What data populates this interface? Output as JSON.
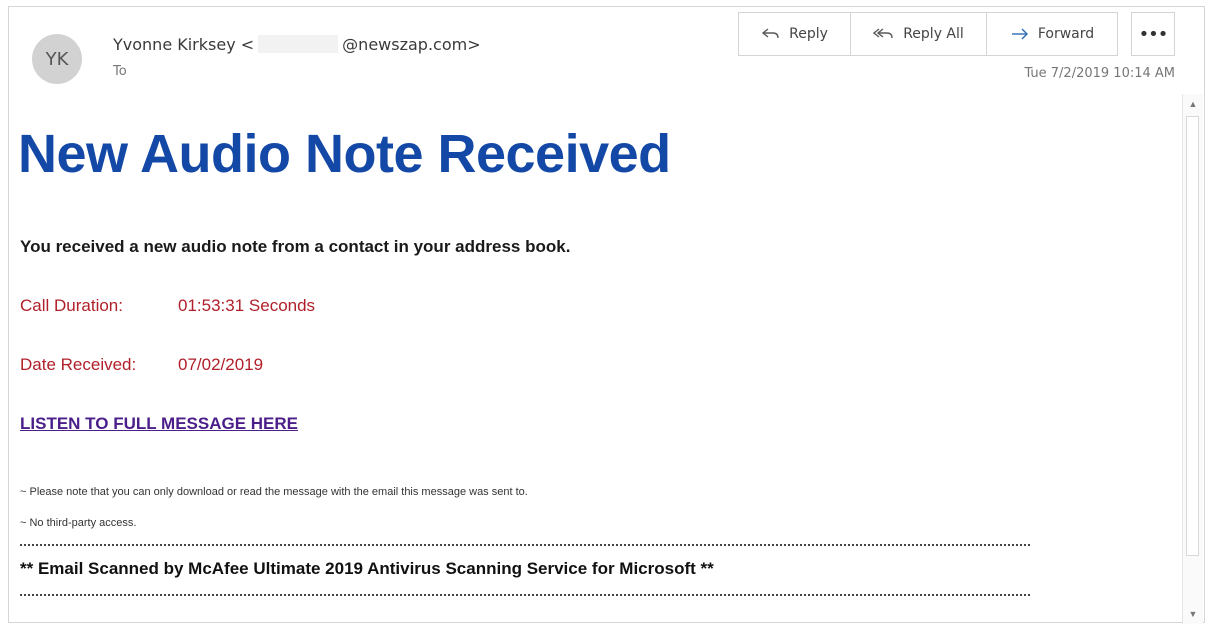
{
  "header": {
    "avatar_initials": "YK",
    "sender_name": "Yvonne Kirksey <",
    "sender_domain": "@newszap.com>",
    "to_label": "To",
    "date": "Tue 7/2/2019 10:14 AM"
  },
  "toolbar": {
    "reply_label": "Reply",
    "reply_all_label": "Reply All",
    "forward_label": "Forward",
    "more_label": "•••",
    "reply_icon": "reply-arrow-icon",
    "reply_all_icon": "reply-all-arrow-icon",
    "forward_icon": "forward-arrow-icon"
  },
  "body": {
    "headline": "New Audio Note Received",
    "intro": "You received a new audio note from a contact in your address book.",
    "duration_label": "Call Duration:",
    "duration_value": "01:53:31 Seconds",
    "date_label": "Date Received:",
    "date_value": "07/02/2019",
    "listen_link": "LISTEN TO FULL MESSAGE HERE",
    "note_1": "~ Please note that you can only download or read the message with the email this message was sent to.",
    "note_2": "~ No third-party access.",
    "scanned": "** Email Scanned by McAfee Ultimate 2019 Antivirus Scanning Service for Microsoft **"
  },
  "colors": {
    "headline": "#1448a6",
    "detail_text": "#b0202a",
    "link": "#4b1e8a",
    "avatar_bg": "#d2d2d2"
  }
}
